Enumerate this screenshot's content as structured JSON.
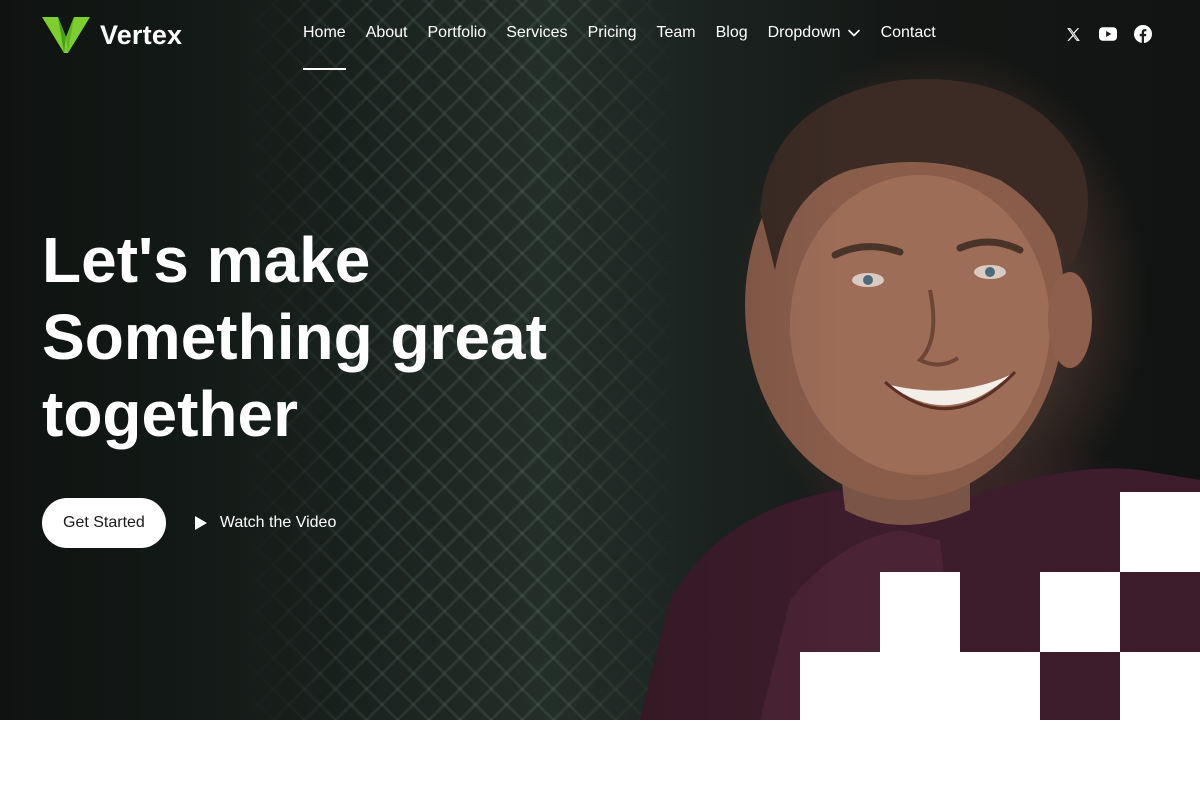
{
  "brand": {
    "name": "Vertex",
    "logo_color_light": "#8bd83a",
    "logo_color_dark": "#4a9d1c"
  },
  "nav": {
    "items": [
      {
        "label": "Home",
        "active": true
      },
      {
        "label": "About"
      },
      {
        "label": "Portfolio"
      },
      {
        "label": "Services"
      },
      {
        "label": "Pricing"
      },
      {
        "label": "Team"
      },
      {
        "label": "Blog"
      },
      {
        "label": "Dropdown",
        "has_submenu": true
      },
      {
        "label": "Contact"
      }
    ]
  },
  "socials": [
    "x-icon",
    "youtube-icon",
    "facebook-icon"
  ],
  "hero": {
    "headline": [
      "Let's make",
      "Something great",
      "together"
    ],
    "cta_primary": "Get Started",
    "cta_video": "Watch the Video"
  },
  "colors": {
    "text_on_dark": "#ffffff",
    "accent": "#7ccf2e",
    "page_bg": "#ffffff"
  }
}
